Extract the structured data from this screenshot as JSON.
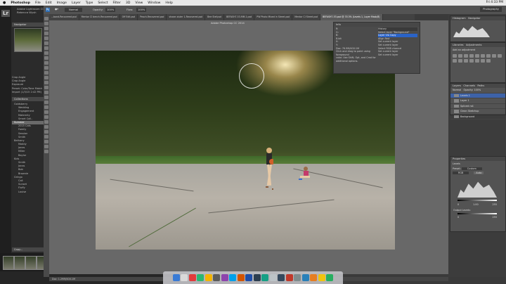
{
  "menubar": {
    "app": "Photoshop",
    "items": [
      "File",
      "Edit",
      "Image",
      "Layer",
      "Type",
      "Select",
      "Filter",
      "3D",
      "View",
      "Window",
      "Help"
    ],
    "clock": "Fri 4:33 PM"
  },
  "lightroom": {
    "logo": "Lr",
    "title_line1": "Adobe Lightroom CC",
    "title_line2": "Rebecca Wysh",
    "navigator_label": "Navigator",
    "menu_items": [
      "Crop Angle",
      "Crop Angle",
      "Exposure",
      "Preset: Color/Tone Match",
      "Import (1/3/15 2:42 PM)"
    ],
    "collections_label": "Collections",
    "collections": [
      "Goldsberry",
      "Wedding",
      "Engagement",
      "Maternity",
      "Smart Coll..",
      "Summer",
      "2015 Cats",
      "Family",
      "Session",
      "Smith",
      "Bethany",
      "Maddy",
      "Jones",
      "Miller",
      "Baylor",
      "Kids",
      "Smith",
      "Jonas",
      "Bob",
      "Brownie",
      "Gringo",
      "Cali",
      "Sunset",
      "Fluffy",
      "Louise"
    ],
    "selected_collection": "Summer",
    "copy_label": "Copy...",
    "filmstrip_label": "Filmstrip"
  },
  "photoshop": {
    "window_title": "Adobe Photoshop CC 2014",
    "options": {
      "opacity_label": "Opacity:",
      "opacity_value": "100%",
      "flow_label": "Flow:",
      "flow_value": "100%",
      "mode": "Normal"
    },
    "tabs": [
      "...bond-Recovered.psd",
      "Mentor CI bench-Recovered.psd",
      "Off Edit.psd",
      "Peach-Recovered.psd",
      "shawn sister 1-Recovered.psd",
      "Bee Stef.psd",
      "BEFASH7-53-MM-1.psd",
      "PW Photo Mixed in Street.psd",
      "Mentor CI Street.psd",
      "BEFASH7-53.psd @ 33.3% (Levels 1, Layer Mask/8)"
    ],
    "status_text": "Doc: 1.29M/400.1M",
    "float_panel": {
      "title": "Info",
      "left_lines": [
        "R:",
        "G:",
        "B:",
        "8-bit",
        "X:",
        "Y:",
        "Doc: 76.9M/400.1M",
        "Click and drag to paint using foreground",
        "color. Use Shift, Opt, and Cmd for",
        "additional options."
      ],
      "right_title": "History",
      "right_items": [
        "Select layer \"Background\"",
        "Layer Via Copy",
        "Align Fast",
        "Set current layer",
        "Set current layer",
        "Select RGB channel",
        "Set current layer",
        "Set current layer"
      ],
      "right_selected": "Layer Via Copy"
    },
    "panels": {
      "top_tabs": [
        "Histogram",
        "Navigator"
      ],
      "adjust_tabs": [
        "Libraries",
        "Adjustments"
      ],
      "add_adjustment": "Add an adjustment",
      "layers_tabs": [
        "Layers",
        "Channels",
        "Paths"
      ],
      "layer_kind": "Kind",
      "layer_mode": "Normal",
      "layer_opacity": "Opacity: 100%",
      "layers": [
        "Levels 1",
        "Layer 1",
        "Spliced rs4",
        "Clean Sketchup",
        "Background"
      ],
      "selected_layer": "Levels 1",
      "properties_title": "Properties",
      "properties_sub": "Levels",
      "preset_label": "Preset:",
      "preset_value": "Custom",
      "channel_value": "RGB",
      "auto_label": "Auto",
      "input_values": [
        "0",
        "1.00",
        "255"
      ],
      "output_label": "Output Levels:",
      "output_values": [
        "0",
        "255"
      ]
    }
  },
  "dock_colors": [
    "#3a7bd5",
    "#d9d9d9",
    "#e23c3c",
    "#2bb673",
    "#f4b400",
    "#5c5c5c",
    "#8e44ad",
    "#00a0e9",
    "#d35400",
    "#1f4ea8",
    "#2c3e50",
    "#16a085",
    "#bdc3c7",
    "#34495e",
    "#c0392b",
    "#7f8c8d",
    "#2980b9",
    "#e67e22",
    "#f1c40f",
    "#27ae60"
  ]
}
